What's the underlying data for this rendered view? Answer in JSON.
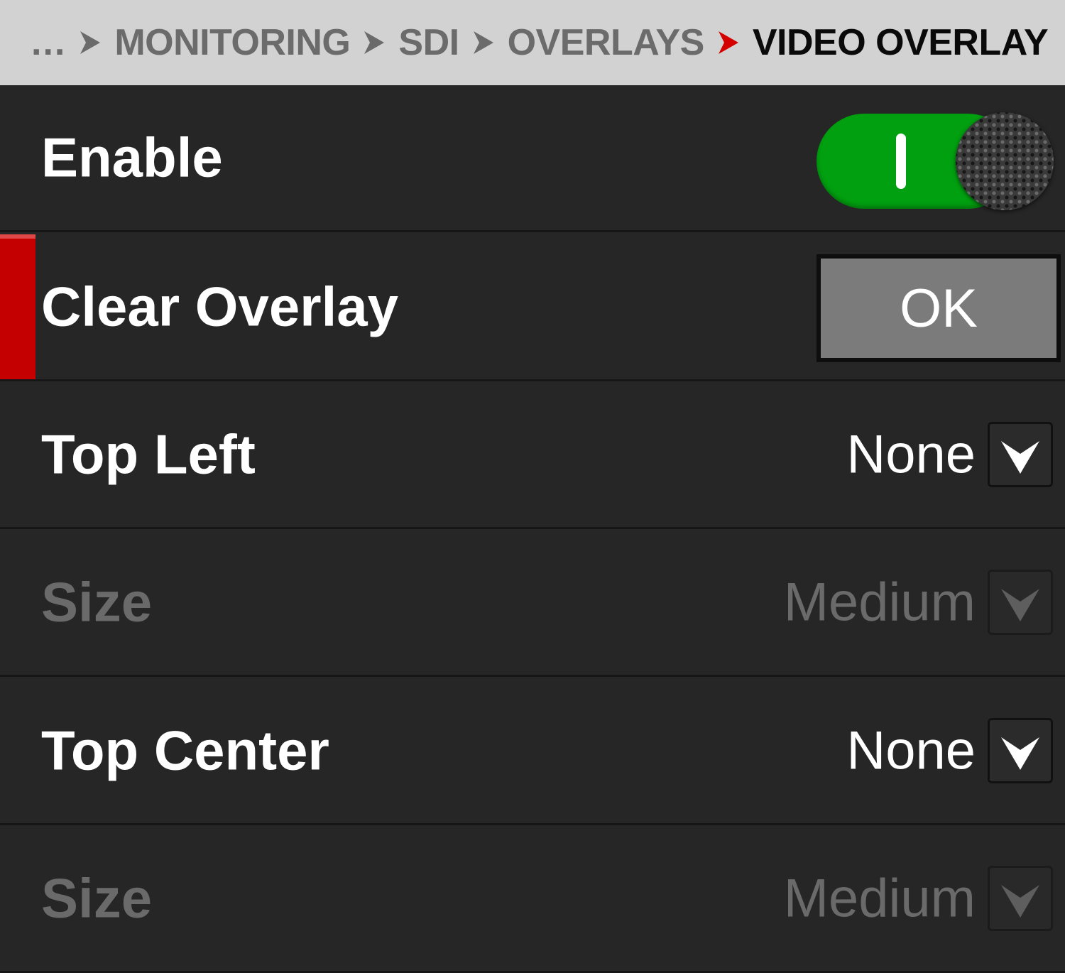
{
  "breadcrumb": {
    "items": [
      {
        "label": "...",
        "current": false
      },
      {
        "label": "MONITORING",
        "current": false
      },
      {
        "label": "SDI",
        "current": false
      },
      {
        "label": "OVERLAYS",
        "current": false
      },
      {
        "label": "VIDEO OVERLAY",
        "current": true
      }
    ]
  },
  "colors": {
    "accent_red": "#c40000",
    "toggle_on_green": "#00a010",
    "background": "#262626",
    "header_bg": "#d2d2d2"
  },
  "rows": {
    "enable": {
      "label": "Enable",
      "toggle_state": "on"
    },
    "clear_overlay": {
      "label": "Clear Overlay",
      "button_label": "OK"
    },
    "top_left": {
      "label": "Top Left",
      "value": "None"
    },
    "top_left_size": {
      "label": "Size",
      "value": "Medium",
      "enabled": false
    },
    "top_center": {
      "label": "Top Center",
      "value": "None"
    },
    "top_center_size": {
      "label": "Size",
      "value": "Medium",
      "enabled": false
    }
  },
  "icons": {
    "breadcrumb_separator": "chevron-right-icon",
    "dropdown": "chevron-down-icon"
  }
}
